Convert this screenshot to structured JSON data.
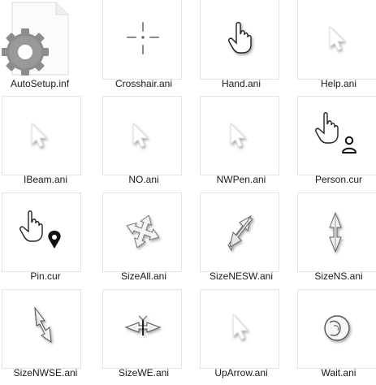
{
  "files": [
    {
      "name": "AutoSetup.inf",
      "icon": "inf-settings-file-icon"
    },
    {
      "name": "Crosshair.ani",
      "icon": "crosshair-cursor-icon"
    },
    {
      "name": "Hand.ani",
      "icon": "hand-cursor-icon"
    },
    {
      "name": "Help.ani",
      "icon": "help-cursor-icon"
    },
    {
      "name": "IBeam.ani",
      "icon": "ibeam-cursor-icon"
    },
    {
      "name": "NO.ani",
      "icon": "no-cursor-icon"
    },
    {
      "name": "NWPen.ani",
      "icon": "nwpen-cursor-icon"
    },
    {
      "name": "Person.cur",
      "icon": "person-cursor-icon"
    },
    {
      "name": "Pin.cur",
      "icon": "pin-cursor-icon"
    },
    {
      "name": "SizeAll.ani",
      "icon": "sizeall-cursor-icon"
    },
    {
      "name": "SizeNESW.ani",
      "icon": "sizenesw-cursor-icon"
    },
    {
      "name": "SizeNS.ani",
      "icon": "sizens-cursor-icon"
    },
    {
      "name": "SizeNWSE.ani",
      "icon": "sizenwse-cursor-icon"
    },
    {
      "name": "SizeWE.ani",
      "icon": "sizewe-cursor-icon"
    },
    {
      "name": "UpArrow.ani",
      "icon": "uparrow-cursor-icon"
    },
    {
      "name": "Wait.ani",
      "icon": "wait-cursor-icon"
    }
  ]
}
